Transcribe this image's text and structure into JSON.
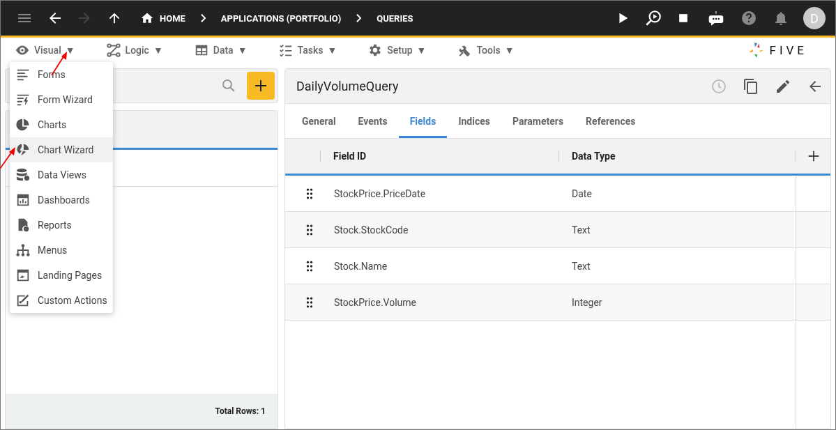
{
  "breadcrumbs": [
    {
      "kind": "home",
      "label": "HOME"
    },
    {
      "kind": "crumb",
      "label": "APPLICATIONS (PORTFOLIO)"
    },
    {
      "kind": "crumb",
      "label": "QUERIES"
    }
  ],
  "avatar": "D",
  "menus": [
    {
      "kind": "eye",
      "label": "Visual",
      "caret": "▼"
    },
    {
      "kind": "logic",
      "label": "Logic",
      "caret": "▼"
    },
    {
      "kind": "table",
      "label": "Data",
      "caret": "▼"
    },
    {
      "kind": "tasks",
      "label": "Tasks",
      "caret": "▼"
    },
    {
      "kind": "gear",
      "label": "Setup",
      "caret": "▼"
    },
    {
      "kind": "tools",
      "label": "Tools",
      "caret": "▼"
    }
  ],
  "logo": "FIVE",
  "dropdown": [
    {
      "kind": "forms",
      "label": "Forms",
      "selected": false
    },
    {
      "kind": "formwizard",
      "label": "Form Wizard",
      "selected": false
    },
    {
      "kind": "charts",
      "label": "Charts",
      "selected": false
    },
    {
      "kind": "chartwizard",
      "label": "Chart Wizard",
      "selected": true
    },
    {
      "kind": "dataviews",
      "label": "Data Views",
      "selected": false
    },
    {
      "kind": "dashboards",
      "label": "Dashboards",
      "selected": false
    },
    {
      "kind": "reports",
      "label": "Reports",
      "selected": false
    },
    {
      "kind": "menus",
      "label": "Menus",
      "selected": false
    },
    {
      "kind": "landing",
      "label": "Landing Pages",
      "selected": false
    },
    {
      "kind": "custom",
      "label": "Custom Actions",
      "selected": false
    }
  ],
  "left_panel": {
    "footer": "Total Rows: 1"
  },
  "record": {
    "title": "DailyVolumeQuery",
    "tabs": [
      {
        "label": "General",
        "selected": false
      },
      {
        "label": "Events",
        "selected": false
      },
      {
        "label": "Fields",
        "selected": true
      },
      {
        "label": "Indices",
        "selected": false
      },
      {
        "label": "Parameters",
        "selected": false
      },
      {
        "label": "References",
        "selected": false
      }
    ],
    "columns": [
      "Field ID",
      "Data Type"
    ],
    "rows": [
      {
        "field_id": "StockPrice.PriceDate",
        "data_type": "Date"
      },
      {
        "field_id": "Stock.StockCode",
        "data_type": "Text"
      },
      {
        "field_id": "Stock.Name",
        "data_type": "Text"
      },
      {
        "field_id": "StockPrice.Volume",
        "data_type": "Integer"
      }
    ]
  }
}
